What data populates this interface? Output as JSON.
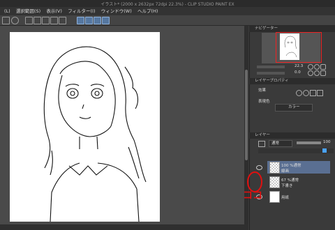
{
  "window": {
    "title": "イラスト* (2000 x 2632px 72dpi 22.3%) - CLIP STUDIO PAINT EX"
  },
  "menu": {
    "items": [
      "(L)",
      "選択範囲(S)",
      "表示(V)",
      "フィルター(I)",
      "ウィンドウ(W)",
      "ヘルプ(H)"
    ]
  },
  "navigator": {
    "title": "ナビゲーター",
    "zoom": "22.3",
    "angle": "0.0"
  },
  "layer_property": {
    "title": "レイヤープロパティ",
    "effect_label": "効果",
    "expression_label": "表現色",
    "expression_value": "カラー"
  },
  "layers_panel": {
    "title": "レイヤー",
    "blend_mode": "通常",
    "opacity": "100",
    "layers": [
      {
        "opacity_mode": "100 %通常",
        "name": "線画",
        "selected": true,
        "visible": true
      },
      {
        "opacity_mode": "67 %通常",
        "name": "下書き",
        "selected": false,
        "visible": false
      },
      {
        "opacity_mode": "",
        "name": "用紙",
        "selected": false,
        "visible": true
      }
    ]
  },
  "annotation": {
    "text": "ココ",
    "color": "#e01010"
  },
  "colors": {
    "accent": "#5577a0",
    "selection": "#5a6f92",
    "red": "#e01010"
  }
}
